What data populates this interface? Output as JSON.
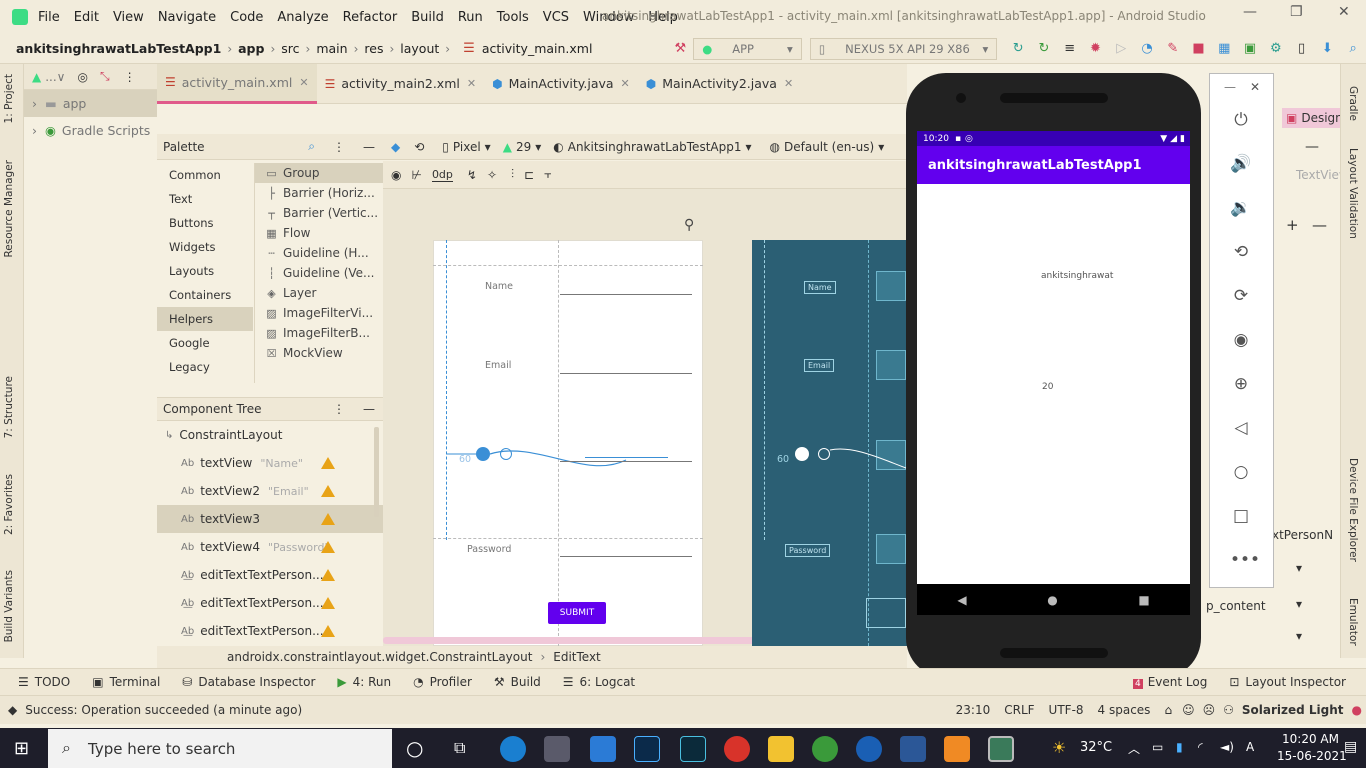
{
  "menu": [
    "File",
    "Edit",
    "View",
    "Navigate",
    "Code",
    "Analyze",
    "Refactor",
    "Build",
    "Run",
    "Tools",
    "VCS",
    "Window",
    "Help"
  ],
  "window_title": "ankitsinghrawatLabTestApp1 - activity_main.xml [ankitsinghrawatLabTestApp1.app] - Android Studio",
  "breadcrumb": [
    "ankitsinghrawatLabTestApp1",
    "app",
    "src",
    "main",
    "res",
    "layout",
    "activity_main.xml"
  ],
  "run_config": "APP",
  "device": "NEXUS 5X API 29 X86",
  "project_tree": {
    "items": [
      "app",
      "Gradle Scripts"
    ]
  },
  "left_tabs": [
    "1: Project",
    "Resource Manager",
    "7: Structure",
    "2: Favorites",
    "Build Variants"
  ],
  "editor_tabs": [
    {
      "label": "activity_main.xml",
      "type": "xml"
    },
    {
      "label": "activity_main2.xml",
      "type": "xml"
    },
    {
      "label": "MainActivity.java",
      "type": "java"
    },
    {
      "label": "MainActivity2.java",
      "type": "java"
    }
  ],
  "palette": {
    "title": "Palette",
    "categories": [
      "Common",
      "Text",
      "Buttons",
      "Widgets",
      "Layouts",
      "Containers",
      "Helpers",
      "Google",
      "Legacy"
    ],
    "items": [
      "Group",
      "Barrier (Horiz...",
      "Barrier (Vertic...",
      "Flow",
      "Guideline (H...",
      "Guideline (Ve...",
      "Layer",
      "ImageFilterVi...",
      "ImageFilterB...",
      "MockView"
    ]
  },
  "component_tree": {
    "title": "Component Tree",
    "root": "ConstraintLayout",
    "items": [
      {
        "name": "textView",
        "attr": "\"Name\""
      },
      {
        "name": "textView2",
        "attr": "\"Email\""
      },
      {
        "name": "textView3",
        "attr": ""
      },
      {
        "name": "textView4",
        "attr": "\"Password\""
      },
      {
        "name": "editTextTextPerson...",
        "attr": ""
      },
      {
        "name": "editTextTextPerson...",
        "attr": ""
      },
      {
        "name": "editTextTextPerson...",
        "attr": ""
      }
    ]
  },
  "layout_toolbar": {
    "device": "Pixel",
    "api": "29",
    "theme": "AnkitsinghrawatLabTestApp1",
    "locale": "Default (en-us)",
    "margin": "0dp"
  },
  "blueprint": {
    "name_label": "Name",
    "email_label": "Email",
    "password_label": "Password",
    "submit": "SUBMIT",
    "margin_value": "60"
  },
  "right_panel": {
    "design": "Design",
    "textview": "TextView",
    "xtperson": "xtPersonN",
    "wrap": "p_content"
  },
  "right_tabs": [
    "Gradle",
    "Layout Validation",
    "Device File Explorer",
    "Emulator"
  ],
  "emulator": {
    "time": "10:20",
    "app_title": "ankitsinghrawatLabTestApp1",
    "text1": "ankitsinghrawat",
    "text2": "20"
  },
  "status_path": [
    "androidx.constraintlayout.widget.ConstraintLayout",
    "EditText"
  ],
  "bottom_tabs": [
    "TODO",
    "Terminal",
    "Database Inspector",
    "4: Run",
    "Profiler",
    "Build",
    "6: Logcat"
  ],
  "event_log": "Event Log",
  "event_count": "4",
  "layout_inspector": "Layout Inspector",
  "status": {
    "message": "Success: Operation succeeded (a minute ago)",
    "position": "23:10",
    "line_sep": "CRLF",
    "encoding": "UTF-8",
    "indent": "4 spaces",
    "theme": "Solarized Light"
  },
  "taskbar": {
    "search": "Type here to search",
    "temp": "32°C",
    "time": "10:20 AM",
    "date": "15-06-2021"
  },
  "colors": {
    "accent": "#6200ee",
    "status": "#3700b3",
    "blueprint": "#2b5f74",
    "tab_active": "#e05a8a"
  }
}
